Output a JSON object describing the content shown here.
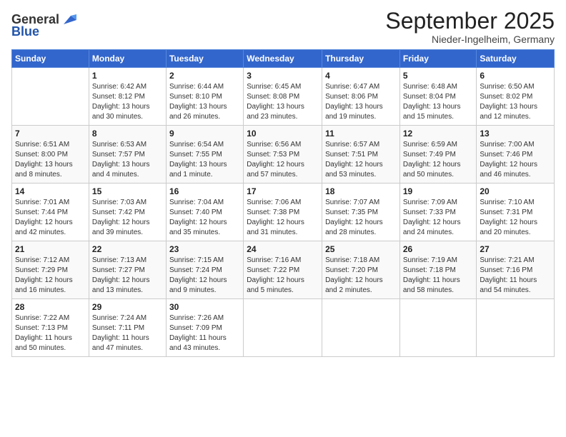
{
  "header": {
    "logo_line1": "General",
    "logo_line2": "Blue",
    "month": "September 2025",
    "location": "Nieder-Ingelheim, Germany"
  },
  "columns": [
    "Sunday",
    "Monday",
    "Tuesday",
    "Wednesday",
    "Thursday",
    "Friday",
    "Saturday"
  ],
  "weeks": [
    [
      {
        "day": "",
        "info": ""
      },
      {
        "day": "1",
        "info": "Sunrise: 6:42 AM\nSunset: 8:12 PM\nDaylight: 13 hours\nand 30 minutes."
      },
      {
        "day": "2",
        "info": "Sunrise: 6:44 AM\nSunset: 8:10 PM\nDaylight: 13 hours\nand 26 minutes."
      },
      {
        "day": "3",
        "info": "Sunrise: 6:45 AM\nSunset: 8:08 PM\nDaylight: 13 hours\nand 23 minutes."
      },
      {
        "day": "4",
        "info": "Sunrise: 6:47 AM\nSunset: 8:06 PM\nDaylight: 13 hours\nand 19 minutes."
      },
      {
        "day": "5",
        "info": "Sunrise: 6:48 AM\nSunset: 8:04 PM\nDaylight: 13 hours\nand 15 minutes."
      },
      {
        "day": "6",
        "info": "Sunrise: 6:50 AM\nSunset: 8:02 PM\nDaylight: 13 hours\nand 12 minutes."
      }
    ],
    [
      {
        "day": "7",
        "info": "Sunrise: 6:51 AM\nSunset: 8:00 PM\nDaylight: 13 hours\nand 8 minutes."
      },
      {
        "day": "8",
        "info": "Sunrise: 6:53 AM\nSunset: 7:57 PM\nDaylight: 13 hours\nand 4 minutes."
      },
      {
        "day": "9",
        "info": "Sunrise: 6:54 AM\nSunset: 7:55 PM\nDaylight: 13 hours\nand 1 minute."
      },
      {
        "day": "10",
        "info": "Sunrise: 6:56 AM\nSunset: 7:53 PM\nDaylight: 12 hours\nand 57 minutes."
      },
      {
        "day": "11",
        "info": "Sunrise: 6:57 AM\nSunset: 7:51 PM\nDaylight: 12 hours\nand 53 minutes."
      },
      {
        "day": "12",
        "info": "Sunrise: 6:59 AM\nSunset: 7:49 PM\nDaylight: 12 hours\nand 50 minutes."
      },
      {
        "day": "13",
        "info": "Sunrise: 7:00 AM\nSunset: 7:46 PM\nDaylight: 12 hours\nand 46 minutes."
      }
    ],
    [
      {
        "day": "14",
        "info": "Sunrise: 7:01 AM\nSunset: 7:44 PM\nDaylight: 12 hours\nand 42 minutes."
      },
      {
        "day": "15",
        "info": "Sunrise: 7:03 AM\nSunset: 7:42 PM\nDaylight: 12 hours\nand 39 minutes."
      },
      {
        "day": "16",
        "info": "Sunrise: 7:04 AM\nSunset: 7:40 PM\nDaylight: 12 hours\nand 35 minutes."
      },
      {
        "day": "17",
        "info": "Sunrise: 7:06 AM\nSunset: 7:38 PM\nDaylight: 12 hours\nand 31 minutes."
      },
      {
        "day": "18",
        "info": "Sunrise: 7:07 AM\nSunset: 7:35 PM\nDaylight: 12 hours\nand 28 minutes."
      },
      {
        "day": "19",
        "info": "Sunrise: 7:09 AM\nSunset: 7:33 PM\nDaylight: 12 hours\nand 24 minutes."
      },
      {
        "day": "20",
        "info": "Sunrise: 7:10 AM\nSunset: 7:31 PM\nDaylight: 12 hours\nand 20 minutes."
      }
    ],
    [
      {
        "day": "21",
        "info": "Sunrise: 7:12 AM\nSunset: 7:29 PM\nDaylight: 12 hours\nand 16 minutes."
      },
      {
        "day": "22",
        "info": "Sunrise: 7:13 AM\nSunset: 7:27 PM\nDaylight: 12 hours\nand 13 minutes."
      },
      {
        "day": "23",
        "info": "Sunrise: 7:15 AM\nSunset: 7:24 PM\nDaylight: 12 hours\nand 9 minutes."
      },
      {
        "day": "24",
        "info": "Sunrise: 7:16 AM\nSunset: 7:22 PM\nDaylight: 12 hours\nand 5 minutes."
      },
      {
        "day": "25",
        "info": "Sunrise: 7:18 AM\nSunset: 7:20 PM\nDaylight: 12 hours\nand 2 minutes."
      },
      {
        "day": "26",
        "info": "Sunrise: 7:19 AM\nSunset: 7:18 PM\nDaylight: 11 hours\nand 58 minutes."
      },
      {
        "day": "27",
        "info": "Sunrise: 7:21 AM\nSunset: 7:16 PM\nDaylight: 11 hours\nand 54 minutes."
      }
    ],
    [
      {
        "day": "28",
        "info": "Sunrise: 7:22 AM\nSunset: 7:13 PM\nDaylight: 11 hours\nand 50 minutes."
      },
      {
        "day": "29",
        "info": "Sunrise: 7:24 AM\nSunset: 7:11 PM\nDaylight: 11 hours\nand 47 minutes."
      },
      {
        "day": "30",
        "info": "Sunrise: 7:26 AM\nSunset: 7:09 PM\nDaylight: 11 hours\nand 43 minutes."
      },
      {
        "day": "",
        "info": ""
      },
      {
        "day": "",
        "info": ""
      },
      {
        "day": "",
        "info": ""
      },
      {
        "day": "",
        "info": ""
      }
    ]
  ]
}
